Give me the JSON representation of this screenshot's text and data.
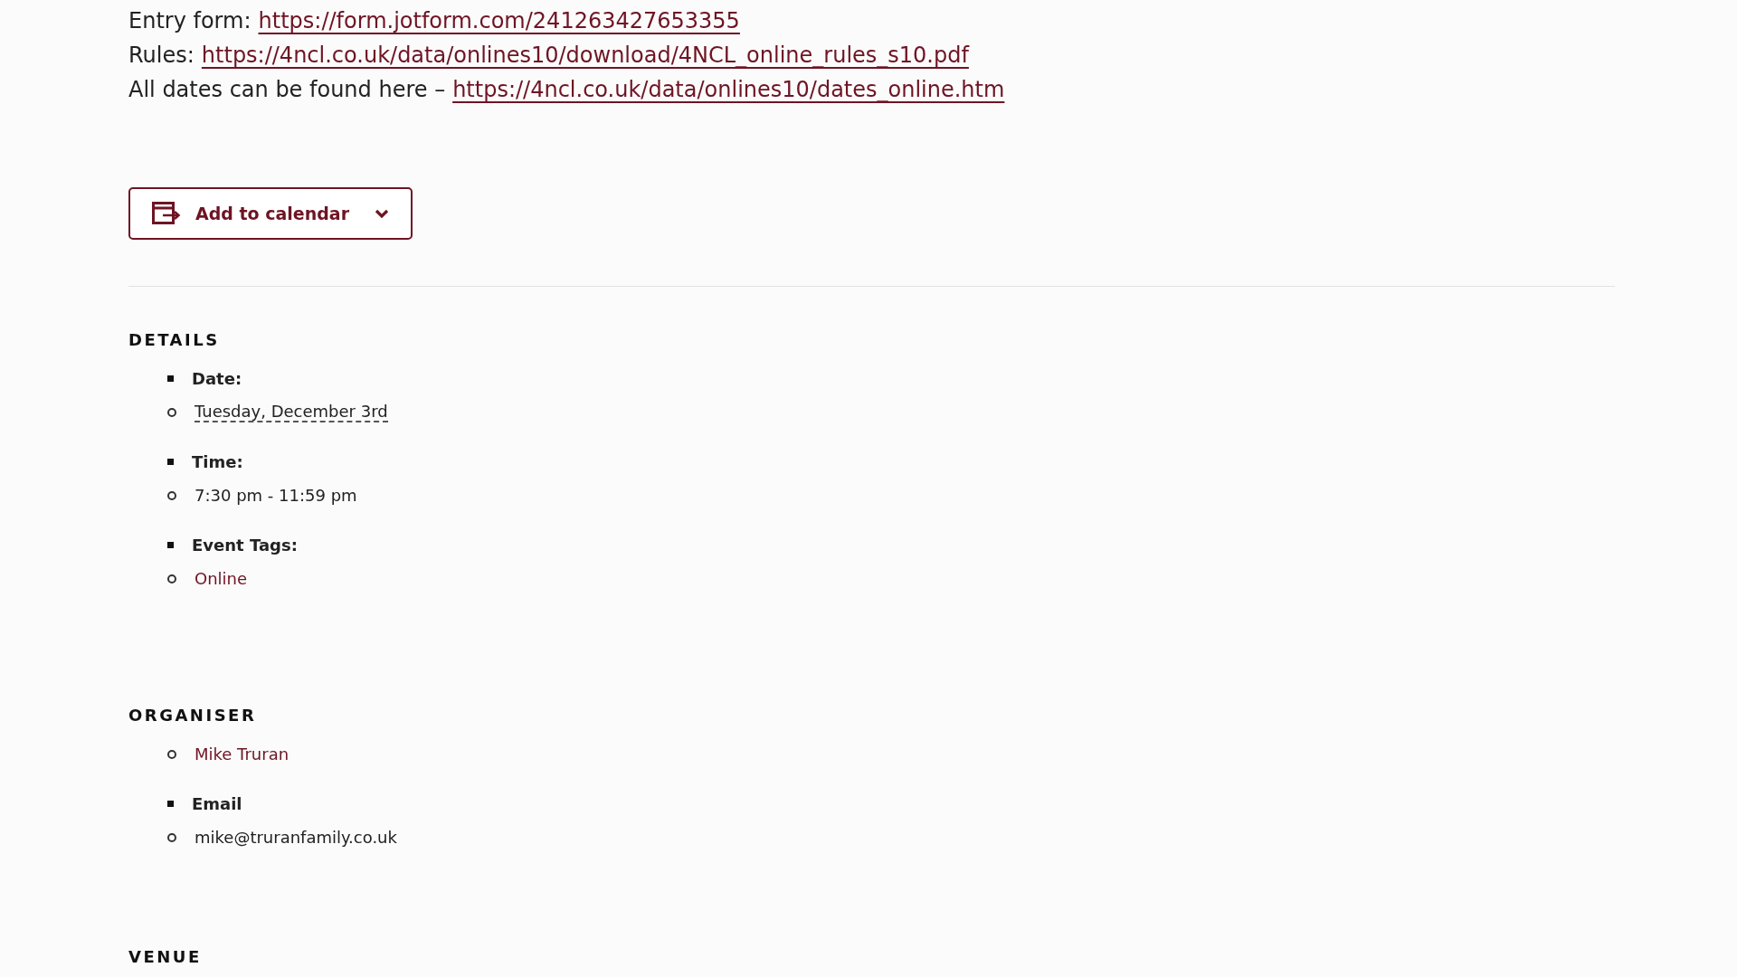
{
  "links": [
    {
      "label": "Entry form:",
      "url": "https://form.jotform.com/241263427653355"
    },
    {
      "label": "Rules:",
      "url": "https://4ncl.co.uk/data/onlines10/download/4NCL_online_rules_s10.pdf"
    },
    {
      "label": "All dates can be found here –",
      "url": "https://4ncl.co.uk/data/onlines10/dates_online.htm"
    }
  ],
  "calendar_button": {
    "label": "Add to calendar"
  },
  "sections": [
    {
      "heading": "DETAILS",
      "items": [
        {
          "kind": "label",
          "text": "Date:"
        },
        {
          "kind": "date",
          "text": "Tuesday, December 3rd"
        },
        {
          "kind": "label",
          "text": "Time:"
        },
        {
          "kind": "value",
          "text": "7:30 pm - 11:59 pm"
        },
        {
          "kind": "label",
          "text": "Event Tags:"
        },
        {
          "kind": "link",
          "text": "Online"
        }
      ]
    },
    {
      "heading": "ORGANISER",
      "items": [
        {
          "kind": "link",
          "text": "Mike Truran"
        },
        {
          "kind": "label",
          "text": "Email"
        },
        {
          "kind": "value",
          "text": "mike@truranfamily.co.uk"
        }
      ]
    },
    {
      "heading": "VENUE"
    }
  ]
}
